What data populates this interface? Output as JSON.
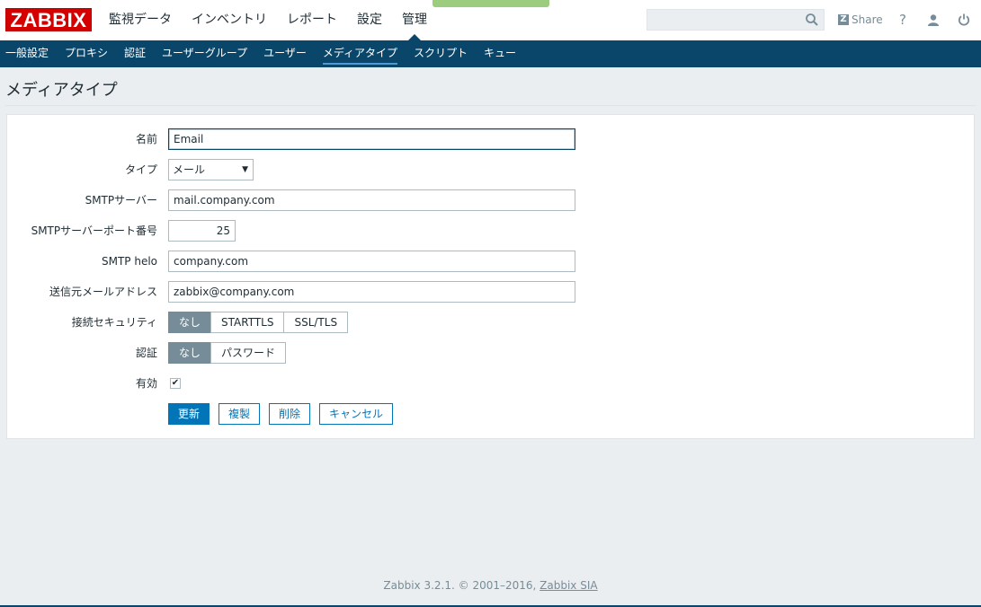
{
  "header": {
    "logo": "ZABBIX",
    "menu": [
      {
        "label": "監視データ"
      },
      {
        "label": "インベントリ"
      },
      {
        "label": "レポート"
      },
      {
        "label": "設定"
      },
      {
        "label": "管理"
      }
    ],
    "search_placeholder": "",
    "share_label": "Share",
    "share_logo": "Z",
    "help_label": "?",
    "icons": [
      "search-icon",
      "share-icon",
      "help-icon",
      "user-icon",
      "power-icon"
    ]
  },
  "submenu": [
    {
      "label": "一般設定"
    },
    {
      "label": "プロキシ"
    },
    {
      "label": "認証"
    },
    {
      "label": "ユーザーグループ"
    },
    {
      "label": "ユーザー"
    },
    {
      "label": "メディアタイプ"
    },
    {
      "label": "スクリプト"
    },
    {
      "label": "キュー"
    }
  ],
  "page": {
    "title": "メディアタイプ"
  },
  "form": {
    "name": {
      "label": "名前",
      "value": "Email"
    },
    "type": {
      "label": "タイプ",
      "value": "メール"
    },
    "smtp_server": {
      "label": "SMTPサーバー",
      "value": "mail.company.com"
    },
    "smtp_port": {
      "label": "SMTPサーバーポート番号",
      "value": "25"
    },
    "smtp_helo": {
      "label": "SMTP helo",
      "value": "company.com"
    },
    "from_email": {
      "label": "送信元メールアドレス",
      "value": "zabbix@company.com"
    },
    "security": {
      "label": "接続セキュリティ",
      "options": [
        "なし",
        "STARTTLS",
        "SSL/TLS"
      ],
      "selected": "なし"
    },
    "auth": {
      "label": "認証",
      "options": [
        "なし",
        "パスワード"
      ],
      "selected": "なし"
    },
    "enabled": {
      "label": "有効",
      "checked": true,
      "mark": "✔"
    },
    "buttons": {
      "update": "更新",
      "clone": "複製",
      "delete": "削除",
      "cancel": "キャンセル"
    }
  },
  "footer": {
    "text": "Zabbix 3.2.1. © 2001–2016, ",
    "link": "Zabbix SIA"
  },
  "colors": {
    "brand_red": "#d40000",
    "nav_dark": "#0a466a",
    "primary_blue": "#0275b8",
    "segment_active": "#768d99"
  }
}
